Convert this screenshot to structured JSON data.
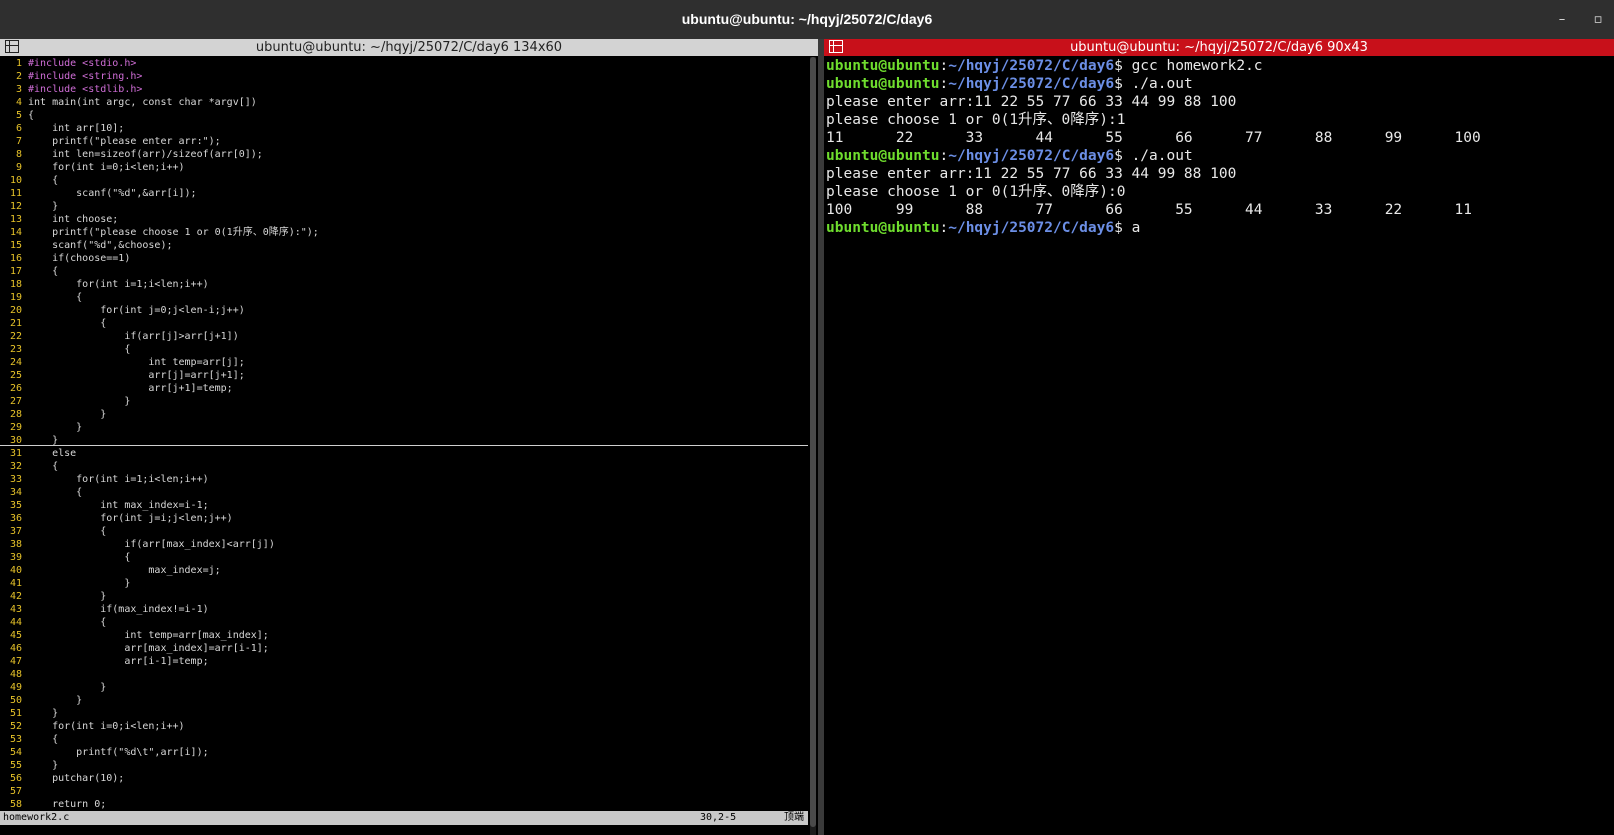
{
  "window": {
    "title": "ubuntu@ubuntu: ~/hqyj/25072/C/day6",
    "minimize_glyph": "–",
    "maximize_glyph": "▫"
  },
  "left_pane": {
    "header": "ubuntu@ubuntu: ~/hqyj/25072/C/day6 134x60",
    "status_file": "homework2.c",
    "status_pos": "30,2-5",
    "status_pct": "顶端",
    "lines": [
      "#include <stdio.h>",
      "#include <string.h>",
      "#include <stdlib.h>",
      "int main(int argc, const char *argv[])",
      "{",
      "    int arr[10];",
      "    printf(\"please enter arr:\");",
      "    int len=sizeof(arr)/sizeof(arr[0]);",
      "    for(int i=0;i<len;i++)",
      "    {",
      "        scanf(\"%d\",&arr[i]);",
      "    }",
      "    int choose;",
      "    printf(\"please choose 1 or 0(1升序、0降序):\");",
      "    scanf(\"%d\",&choose);",
      "    if(choose==1)",
      "    {",
      "        for(int i=1;i<len;i++)",
      "        {",
      "            for(int j=0;j<len-i;j++)",
      "            {",
      "                if(arr[j]>arr[j+1])",
      "                {",
      "                    int temp=arr[j];",
      "                    arr[j]=arr[j+1];",
      "                    arr[j+1]=temp;",
      "                }",
      "            }",
      "        }",
      "    }",
      "    else",
      "    {",
      "        for(int i=1;i<len;i++)",
      "        {",
      "            int max_index=i-1;",
      "            for(int j=i;j<len;j++)",
      "            {",
      "                if(arr[max_index]<arr[j])",
      "                {",
      "                    max_index=j;",
      "                }",
      "            }",
      "            if(max_index!=i-1)",
      "            {",
      "                int temp=arr[max_index];",
      "                arr[max_index]=arr[i-1];",
      "                arr[i-1]=temp;",
      "",
      "            }",
      "        }",
      "    }",
      "    for(int i=0;i<len;i++)",
      "    {",
      "        printf(\"%d\\t\",arr[i]);",
      "    }",
      "    putchar(10);",
      "",
      "    return 0;"
    ]
  },
  "right_pane": {
    "header": "ubuntu@ubuntu: ~/hqyj/25072/C/day6 90x43",
    "prompt_user": "ubuntu@ubuntu",
    "prompt_sep": ":",
    "prompt_path": "~/hqyj/25072/C/day6",
    "prompt_dollar": "$ ",
    "cmd1": "gcc homework2.c",
    "cmd2": "./a.out",
    "out1": "please enter arr:11 22 55 77 66 33 44 99 88 100",
    "out2": "please choose 1 or 0(1升序、0降序):1",
    "out3": "11      22      33      44      55      66      77      88      99      100",
    "cmd3": "./a.out",
    "out4": "please enter arr:11 22 55 77 66 33 44 99 88 100",
    "out5": "please choose 1 or 0(1升序、0降序):0",
    "out6": "100     99      88      77      66      55      44      33      22      11",
    "cmd4": "a"
  }
}
